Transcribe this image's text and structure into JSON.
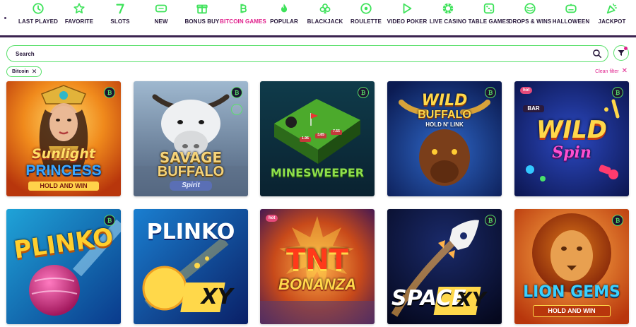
{
  "nav": {
    "items": [
      {
        "label": "LAST PLAYED",
        "icon": "clock-icon",
        "active": false
      },
      {
        "label": "FAVORITE",
        "icon": "star-icon",
        "active": false
      },
      {
        "label": "SLOTS",
        "icon": "seven-icon",
        "active": false
      },
      {
        "label": "NEW",
        "icon": "new-tag-icon",
        "active": false
      },
      {
        "label": "BONUS BUY",
        "icon": "gift-icon",
        "active": false
      },
      {
        "label": "BITCOIN GAMES",
        "icon": "bitcoin-icon",
        "active": true
      },
      {
        "label": "POPULAR",
        "icon": "flame-icon",
        "active": false
      },
      {
        "label": "BLACKJACK",
        "icon": "club-icon",
        "active": false
      },
      {
        "label": "ROULETTE",
        "icon": "roulette-icon",
        "active": false
      },
      {
        "label": "VIDEO POKER",
        "icon": "play-icon",
        "active": false
      },
      {
        "label": "LIVE CASINO",
        "icon": "chip-icon",
        "active": false
      },
      {
        "label": "TABLE GAMES",
        "icon": "dice-icon",
        "active": false
      },
      {
        "label": "DROPS & WINS",
        "icon": "drops-icon",
        "active": false
      },
      {
        "label": "HALLOWEEN",
        "icon": "pumpkin-icon",
        "active": false
      },
      {
        "label": "JACKPOT",
        "icon": "party-icon",
        "active": false
      }
    ]
  },
  "search": {
    "placeholder": "Search"
  },
  "filters": {
    "active_chip": "Bitcoin",
    "clean_label": "Clean filter"
  },
  "colors": {
    "accent_green": "#58e06a",
    "accent_pink": "#e0208c",
    "text_dark": "#2a1a3d"
  },
  "games": [
    {
      "title": "Sunlight",
      "subtitle": "PRINCESS",
      "tag": "HOLD AND WIN",
      "badge": "bitcoin"
    },
    {
      "title": "SAVAGE",
      "subtitle": "BUFFALO",
      "tag": "Spirit",
      "badge": "bitcoin"
    },
    {
      "title": "MINESWEEPER",
      "subtitle": "",
      "tag": "",
      "badge": "bitcoin",
      "multipliers": [
        "1.96",
        "3.85",
        "7.55"
      ]
    },
    {
      "title": "WILD",
      "subtitle": "BUFFALO",
      "tag": "HOLD N' LINK",
      "badge": "bitcoin"
    },
    {
      "title": "WILD",
      "subtitle": "Spin",
      "tag": "BAR",
      "badge": "bitcoin",
      "hot": "hot"
    },
    {
      "title": "PLINKO",
      "subtitle": "",
      "tag": "",
      "badge": "bitcoin"
    },
    {
      "title": "PLINKO",
      "subtitle": "XY",
      "tag": "",
      "badge": "bitcoin"
    },
    {
      "title": "TNT",
      "subtitle": "BONANZA",
      "tag": "",
      "badge": "bitcoin",
      "hot": "hot"
    },
    {
      "title": "SPACE",
      "subtitle": "XY",
      "tag": "",
      "badge": "bitcoin"
    },
    {
      "title": "LION GEMS",
      "subtitle": "HOLD AND WIN",
      "tag": "",
      "badge": "bitcoin"
    }
  ]
}
